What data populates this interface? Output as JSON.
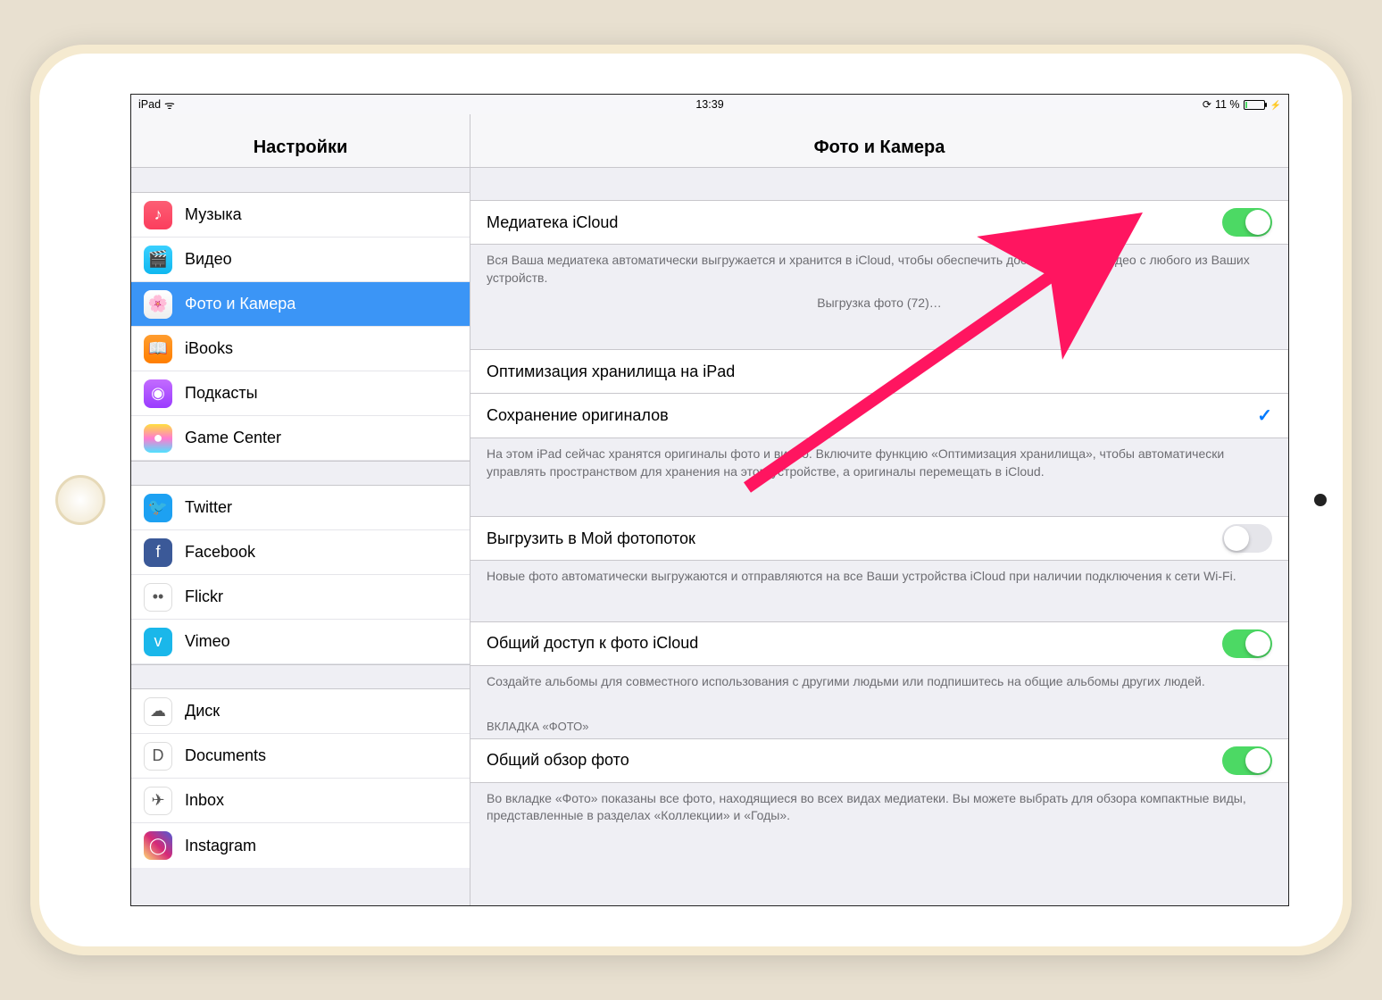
{
  "status": {
    "device": "iPad",
    "time": "13:39",
    "battery_pct": "11 %"
  },
  "sidebar": {
    "title": "Настройки",
    "groups": [
      [
        {
          "id": "music",
          "label": "Музыка",
          "iconBg": "linear-gradient(#fc5e74,#fb3e5d)",
          "glyph": "♪"
        },
        {
          "id": "video",
          "label": "Видео",
          "iconBg": "linear-gradient(#3ad0ff,#0fb8f0)",
          "glyph": "🎬"
        },
        {
          "id": "photos",
          "label": "Фото и Камера",
          "iconBg": "linear-gradient(#fff,#eee)",
          "glyph": "🌸",
          "selected": true
        },
        {
          "id": "ibooks",
          "label": "iBooks",
          "iconBg": "linear-gradient(#ff9d2f,#ff7e00)",
          "glyph": "📖"
        },
        {
          "id": "podcasts",
          "label": "Подкасты",
          "iconBg": "linear-gradient(#c36bff,#9a3cff)",
          "glyph": "◉"
        },
        {
          "id": "gamecenter",
          "label": "Game Center",
          "iconBg": "linear-gradient(#ffdf3f,#ff7bd0 50%,#4fe2ff)",
          "glyph": "●"
        }
      ],
      [
        {
          "id": "twitter",
          "label": "Twitter",
          "iconBg": "#1da1f2",
          "glyph": "🐦"
        },
        {
          "id": "facebook",
          "label": "Facebook",
          "iconBg": "#3b5998",
          "glyph": "f"
        },
        {
          "id": "flickr",
          "label": "Flickr",
          "iconBg": "#fff",
          "glyph": "••"
        },
        {
          "id": "vimeo",
          "label": "Vimeo",
          "iconBg": "#1ab7ea",
          "glyph": "v"
        }
      ],
      [
        {
          "id": "disk",
          "label": "Диск",
          "iconBg": "#fff",
          "glyph": "☁"
        },
        {
          "id": "documents",
          "label": "Documents",
          "iconBg": "#fff",
          "glyph": "D"
        },
        {
          "id": "inbox",
          "label": "Inbox",
          "iconBg": "#fff",
          "glyph": "✈"
        },
        {
          "id": "instagram",
          "label": "Instagram",
          "iconBg": "linear-gradient(45deg,#feda75,#d62976,#4f5bd5)",
          "glyph": "◯"
        }
      ]
    ]
  },
  "detail": {
    "title": "Фото и Камера",
    "sections": [
      {
        "rows": [
          {
            "id": "icloud-library",
            "label": "Медиатека iCloud",
            "type": "toggle",
            "value": true
          }
        ],
        "footer": "Вся Ваша медиатека автоматически выгружается и хранится в iCloud, чтобы обеспечить доступ к фото и видео с любого из Ваших устройств.",
        "footer_center": "Выгрузка фото (72)…"
      },
      {
        "rows": [
          {
            "id": "optimize",
            "label": "Оптимизация хранилища на iPad",
            "type": "check",
            "value": false
          },
          {
            "id": "keep-originals",
            "label": "Сохранение оригиналов",
            "type": "check",
            "value": true
          }
        ],
        "footer": "На этом iPad сейчас хранятся оригиналы фото и видео. Включите функцию «Оптимизация хранилища», чтобы автоматически управлять пространством для хранения на этом устройстве, а оригиналы перемещать в iCloud."
      },
      {
        "rows": [
          {
            "id": "photostream",
            "label": "Выгрузить в Мой фотопоток",
            "type": "toggle",
            "value": false
          }
        ],
        "footer": "Новые фото автоматически выгружаются и отправляются на все Ваши устройства iCloud при наличии подключения к сети Wi-Fi."
      },
      {
        "rows": [
          {
            "id": "shared-icloud",
            "label": "Общий доступ к фото iCloud",
            "type": "toggle",
            "value": true
          }
        ],
        "footer": "Создайте альбомы для совместного использования с другими людьми или подпишитесь на общие альбомы других людей."
      },
      {
        "header": "ВКЛАДКА «ФОТО»",
        "rows": [
          {
            "id": "photo-overview",
            "label": "Общий обзор фото",
            "type": "toggle",
            "value": true
          }
        ],
        "footer": "Во вкладке «Фото» показаны все фото, находящиеся во всех видах медиатеки. Вы можете выбрать для обзора компактные виды, представленные в разделах «Коллекции» и «Годы»."
      }
    ]
  }
}
